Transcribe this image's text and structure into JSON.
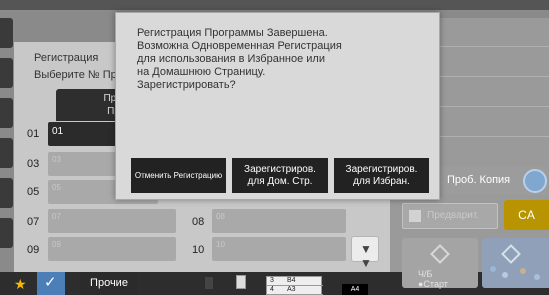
{
  "dialog": {
    "message_lines": [
      "Регистрация Программы Завершена.",
      "Возможна Одновременная Регистрация",
      "для использования в Избранное или",
      "на Домашнюю Страницу.",
      "Зарегистрировать?"
    ],
    "buttons": {
      "cancel": "Отменить Регистрацию",
      "home_line1": "Зарегистриров.",
      "home_line2": "для Дом. Стр.",
      "fav_line1": "Зарегистриров.",
      "fav_line2": "для Избран."
    }
  },
  "panel": {
    "title": "Регистрация",
    "subtitle": "Выберите № Пр",
    "column_header_line1": "Прогр",
    "column_header_line2": "Пред",
    "slots": [
      {
        "num": "01",
        "label": "01",
        "active": true
      },
      {
        "num": "03",
        "label": "03",
        "active": false
      },
      {
        "num": "05",
        "label": "05",
        "active": false
      },
      {
        "num": "07",
        "label": "07",
        "active": false
      },
      {
        "num": "08",
        "label": "08",
        "active": false
      },
      {
        "num": "09",
        "label": "09",
        "active": false
      },
      {
        "num": "10",
        "label": "10",
        "active": false
      }
    ]
  },
  "right_panel": {
    "prob_copy": "Проб. Копия",
    "preview": "Предварит.",
    "ca": "CA",
    "bw_start_line1": "Ч/Б",
    "bw_start_line2": "●Старт"
  },
  "bottom": {
    "other": "Прочие",
    "tray": {
      "row1": [
        "3",
        "B4"
      ],
      "row2": [
        "4",
        "A3"
      ],
      "paper": "A4"
    }
  },
  "colors": {
    "accent_blue": "#4c7fb8",
    "ca_yellow": "#b89400",
    "star": "#f6b800"
  }
}
